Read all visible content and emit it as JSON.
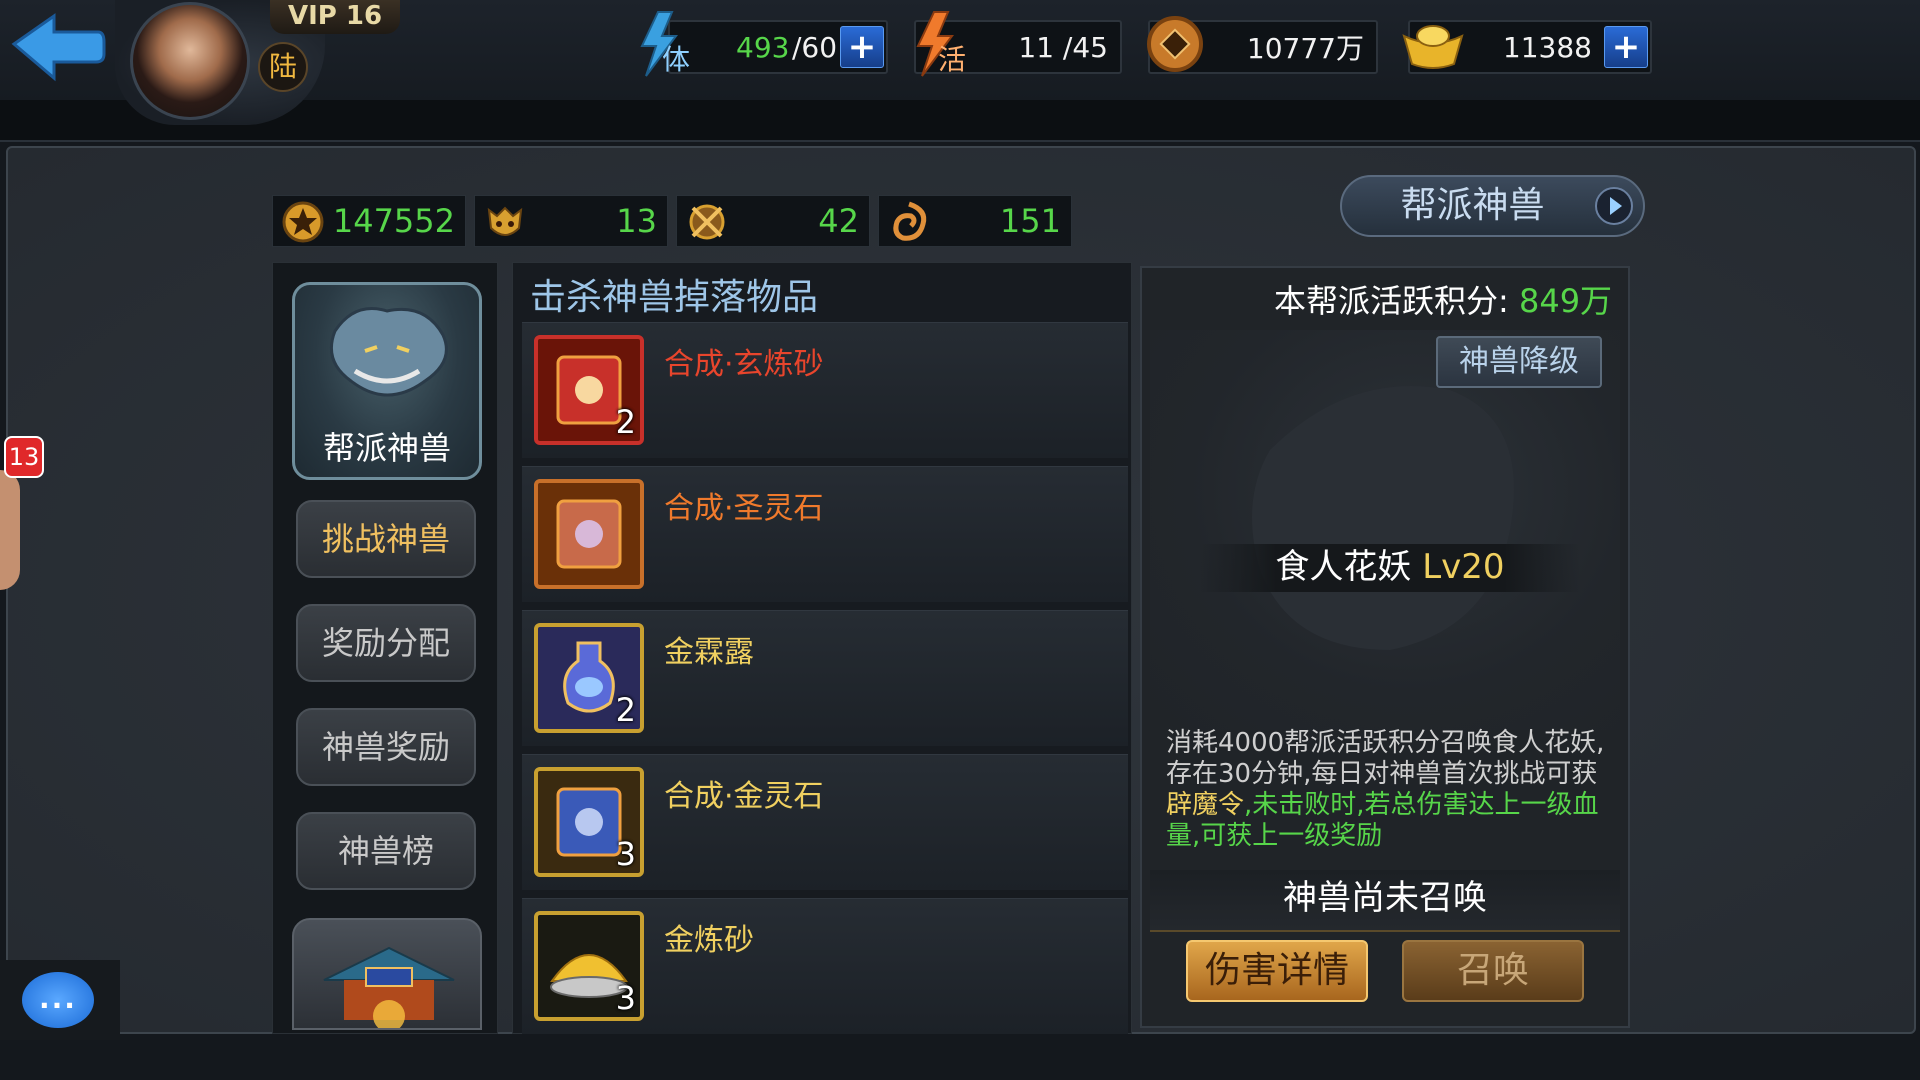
{
  "header": {
    "vip_label": "VIP 16",
    "server_char": "陆",
    "stamina": {
      "icon_char": "体",
      "current": "493",
      "max": "/60"
    },
    "activity": {
      "icon_char": "活",
      "value": "11 /45"
    },
    "coins": "10777万",
    "ingots": "11388"
  },
  "stats": [
    {
      "icon": "gold-medal-icon",
      "value": "147552"
    },
    {
      "icon": "beast-head-icon",
      "value": "13"
    },
    {
      "icon": "crossed-swords-icon",
      "value": "42"
    },
    {
      "icon": "dragon-emblem-icon",
      "value": "151"
    }
  ],
  "guild_beast_button": "帮派神兽",
  "left_menu": {
    "main_label": "帮派神兽",
    "items": [
      "挑战神兽",
      "奖励分配",
      "神兽奖励",
      "神兽榜"
    ]
  },
  "drops": {
    "title": "击杀神兽掉落物品",
    "items": [
      {
        "name": "合成·玄炼砂",
        "count": "2",
        "color": "#e8452c"
      },
      {
        "name": "合成·圣灵石",
        "count": "",
        "color": "#f07a2c"
      },
      {
        "name": "金霖露",
        "count": "2",
        "color": "#f0d060"
      },
      {
        "name": "合成·金灵石",
        "count": "3",
        "color": "#f0d060"
      },
      {
        "name": "金炼砂",
        "count": "3",
        "color": "#f0d060"
      }
    ]
  },
  "right": {
    "activity_label": "本帮派活跃积分: ",
    "activity_value": "849万",
    "downgrade_btn": "神兽降级",
    "beast_name": "食人花妖 ",
    "beast_level": "Lv20",
    "desc_part1": "消耗4000帮派活跃积分召唤食人花妖,存在30分钟,每日对神兽首次挑战可获",
    "desc_part2": "辟魔令",
    "desc_part3": ",未击败时,若总伤害达上一级血量,可获上一级奖励",
    "status": "神兽尚未召唤",
    "btn_damage": "伤害详情",
    "btn_summon": "召唤"
  },
  "notif_count": "13",
  "chat_icon": "..."
}
